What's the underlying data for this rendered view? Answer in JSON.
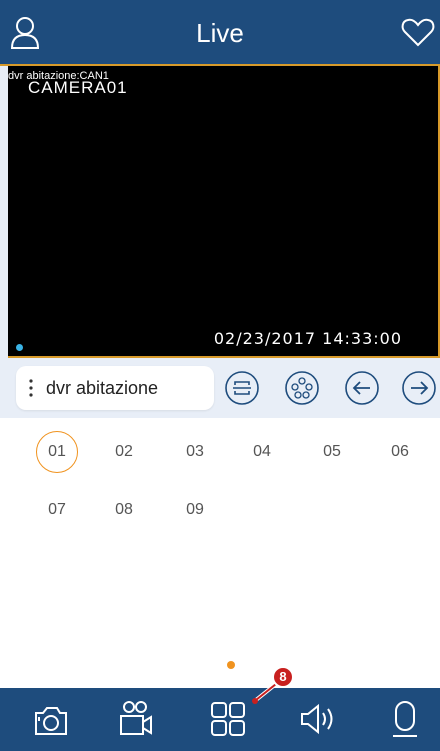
{
  "header": {
    "title": "Live",
    "left_icon": "user-icon",
    "right_icon": "heart-icon"
  },
  "video": {
    "channel_tag": "dvr abitazione:CAN1",
    "camera_name": "CAMERA01",
    "timestamp": "02/23/2017 14:33:00"
  },
  "controls": {
    "device_name": "dvr abitazione",
    "buttons": [
      "capture-frame-icon",
      "film-reel-icon",
      "arrow-left-icon",
      "arrow-right-icon"
    ]
  },
  "channels": {
    "selected": "01",
    "items": [
      "01",
      "02",
      "03",
      "04",
      "05",
      "06",
      "07",
      "08",
      "09"
    ]
  },
  "bottom_bar": {
    "icons": [
      "snapshot-icon",
      "record-video-icon",
      "layout-grid-icon",
      "speaker-icon",
      "microphone-icon"
    ]
  },
  "callout": {
    "number": "8"
  },
  "colors": {
    "primary": "#1e4c7d",
    "accent": "#d79a2a",
    "orange": "#f0931f",
    "callout": "#c8201f"
  }
}
